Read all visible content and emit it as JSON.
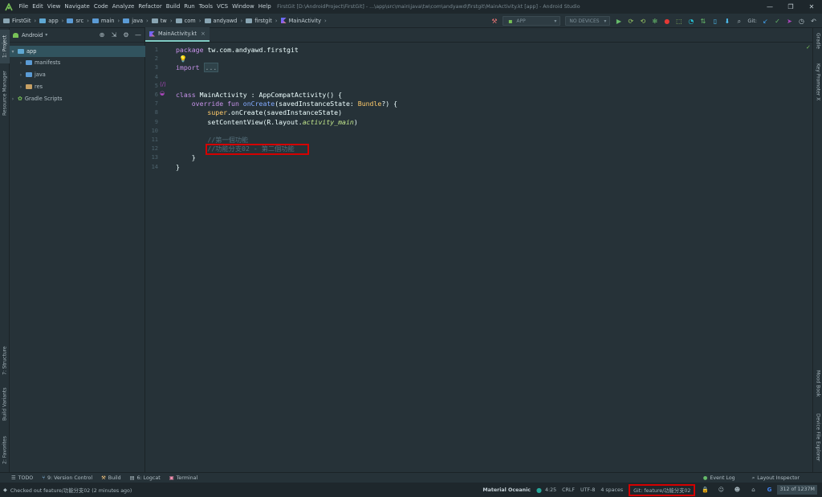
{
  "menubar": {
    "items": [
      "File",
      "Edit",
      "View",
      "Navigate",
      "Code",
      "Analyze",
      "Refactor",
      "Build",
      "Run",
      "Tools",
      "VCS",
      "Window",
      "Help"
    ],
    "window_title": "FirstGit [D:\\AndroidProject\\FirstGit] - ...\\app\\src\\main\\java\\tw\\com\\andyawd\\firstgit\\MainActivity.kt [app] - Android Studio",
    "minimize": "—",
    "maximize": "❐",
    "close": "✕"
  },
  "breadcrumbs": [
    "FirstGit",
    "app",
    "src",
    "main",
    "java",
    "tw",
    "com",
    "andyawd",
    "firstgit",
    "MainActivity"
  ],
  "toolbar": {
    "run_config": "APP",
    "device": "NO DEVICES",
    "git_label": "Git:"
  },
  "left_tabs": {
    "project": "1: Project",
    "resource_manager": "Resource Manager",
    "structure": "7: Structure",
    "build_variants": "Build Variants",
    "favorites": "2: Favorites"
  },
  "right_tabs": {
    "gradle": "Gradle",
    "key_promoter": "Key Promoter X",
    "mood_book": "Mood Book",
    "device_file_explorer": "Device File Explorer"
  },
  "project_panel": {
    "view_mode": "Android",
    "tree": [
      {
        "label": "app",
        "icon": "module-folder-icon",
        "expanded": true,
        "selected": true,
        "depth": 0
      },
      {
        "label": "manifests",
        "icon": "folder-icon",
        "expanded": false,
        "selected": false,
        "depth": 1
      },
      {
        "label": "java",
        "icon": "folder-icon",
        "expanded": false,
        "selected": false,
        "depth": 1
      },
      {
        "label": "res",
        "icon": "res-folder-icon",
        "expanded": false,
        "selected": false,
        "depth": 1
      },
      {
        "label": "Gradle Scripts",
        "icon": "gradle-icon",
        "expanded": false,
        "selected": false,
        "depth": 0
      }
    ]
  },
  "editor": {
    "tab_label": "MainActivity.kt",
    "line_numbers": [
      "1",
      "2",
      "3",
      "4",
      "5",
      "6",
      "7",
      "8",
      "9",
      "10",
      "11",
      "12",
      "13",
      "14"
    ],
    "lines": {
      "l1_kw": "package",
      "l1_rest": " tw.com.andyawd.firstgit",
      "l3_kw": "import",
      "l3_fold": "...",
      "l6_kw": "class",
      "l6_rest": " MainActivity : AppCompatActivity() {",
      "l7_kw": "    override fun",
      "l7_fn": " onCreate",
      "l7_a": "(savedInstanceState: ",
      "l7_ty": "Bundle",
      "l7_b": "?) {",
      "l8_kw": "        super",
      "l8_rest": ".onCreate(savedInstanceState)",
      "l9_a": "        setContentView(R.layout.",
      "l9_it": "activity_main",
      "l9_b": ")",
      "l11": "        //第一個功能",
      "l12": "        //功能分支02 - 第二個功能",
      "l13": "    }",
      "l14": "}"
    }
  },
  "bottom_tabs": {
    "todo": "TODO",
    "version_control": "9: Version Control",
    "build": "Build",
    "logcat": "6: Logcat",
    "terminal": "Terminal",
    "event_log": "Event Log",
    "layout_inspector": "Layout Inspector"
  },
  "statusbar": {
    "message": "Checked out feature/功能分支02 (2 minutes ago)",
    "theme": "Material Oceanic",
    "position": "4:25",
    "line_sep": "CRLF",
    "encoding": "UTF-8",
    "indent": "4 spaces",
    "git_branch": "Git: feature/功能分支02",
    "memory": "312 of 1237M"
  },
  "colors": {
    "background": "#263238",
    "keyword": "#c792ea",
    "function": "#82aaff",
    "type": "#ffcb6b",
    "italic_ref": "#c3e88d",
    "comment": "#546e7a",
    "highlight_box": "#d50000",
    "accent": "#80cbc4"
  }
}
